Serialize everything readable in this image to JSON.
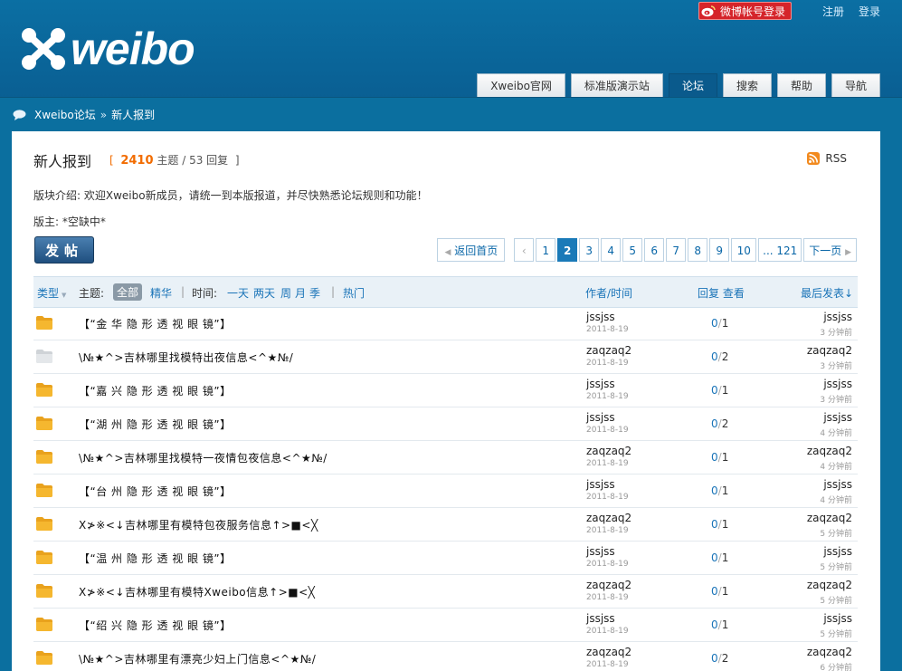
{
  "header": {
    "logo_text": "weibo",
    "weibo_login": "微博帐号登录",
    "register": "注册",
    "login": "登录",
    "nav": [
      "Xweibo官网",
      "标准版演示站",
      "论坛",
      "搜索",
      "帮助",
      "导航"
    ],
    "nav_active_index": 2
  },
  "breadcrumb": {
    "home": "Xweibo论坛",
    "sep": "»",
    "current": "新人报到"
  },
  "forum": {
    "title": "新人报到",
    "bracket_open": "[",
    "topics": "2410",
    "topics_label": "主题",
    "slash": "/",
    "replies": "53",
    "replies_label": "回复",
    "bracket_close": "]",
    "rss": "RSS",
    "intro": "版块介绍: 欢迎Xweibo新成员，请统一到本版报道，并尽快熟悉论坛规则和功能！",
    "moderator": "版主: *空缺中*",
    "post_button": "发帖"
  },
  "pager": {
    "home": "返回首页",
    "prev": "‹",
    "pages": [
      "1",
      "2",
      "3",
      "4",
      "5",
      "6",
      "7",
      "8",
      "9",
      "10"
    ],
    "current": "2",
    "more": "... 121",
    "next": "下一页"
  },
  "filter": {
    "type": "类型",
    "subject": "主题:",
    "all": "全部",
    "digest": "精华",
    "pipe": "|",
    "time": "时间:",
    "t1": "一天",
    "t2": "两天",
    "t3": "周",
    "t4": "月",
    "t5": "季",
    "hot": "热门",
    "author_time": "作者/时间",
    "replies_views": "回复 查看",
    "last_post": "最后发表↓"
  },
  "colors": {
    "header_blue": "#0b6fa3",
    "accent_orange": "#f26c00",
    "link_blue": "#1a74b8",
    "folder": "#f5b72f"
  },
  "threads": [
    {
      "title": "【“金 华 隐 形 透 视 眼 镜”】",
      "author": "jssjss",
      "date": "2011-8-19",
      "replies": "0",
      "views": "1",
      "last_user": "jssjss",
      "last_time": "3 分钟前",
      "icon": "folder"
    },
    {
      "title": "\\№★^>吉林哪里找模特出夜信息<^★№/",
      "author": "zaqzaq2",
      "date": "2011-8-19",
      "replies": "0",
      "views": "2",
      "last_user": "zaqzaq2",
      "last_time": "3 分钟前",
      "icon": "folder-gray"
    },
    {
      "title": "【“嘉 兴 隐 形 透 视 眼 镜”】",
      "author": "jssjss",
      "date": "2011-8-19",
      "replies": "0",
      "views": "1",
      "last_user": "jssjss",
      "last_time": "3 分钟前",
      "icon": "folder"
    },
    {
      "title": "【“湖 州 隐 形 透 视 眼 镜”】",
      "author": "jssjss",
      "date": "2011-8-19",
      "replies": "0",
      "views": "2",
      "last_user": "jssjss",
      "last_time": "4 分钟前",
      "icon": "folder"
    },
    {
      "title": "\\№★^>吉林哪里找模特一夜情包夜信息<^★№/",
      "author": "zaqzaq2",
      "date": "2011-8-19",
      "replies": "0",
      "views": "1",
      "last_user": "zaqzaq2",
      "last_time": "4 分钟前",
      "icon": "folder"
    },
    {
      "title": "【“台 州 隐 形 透 视 眼 镜”】",
      "author": "jssjss",
      "date": "2011-8-19",
      "replies": "0",
      "views": "1",
      "last_user": "jssjss",
      "last_time": "4 分钟前",
      "icon": "folder"
    },
    {
      "title": "X≯※<↓吉林哪里有模特包夜服务信息↑>■<╳",
      "author": "zaqzaq2",
      "date": "2011-8-19",
      "replies": "0",
      "views": "1",
      "last_user": "zaqzaq2",
      "last_time": "5 分钟前",
      "icon": "folder"
    },
    {
      "title": "【“温 州 隐 形 透 视 眼 镜”】",
      "author": "jssjss",
      "date": "2011-8-19",
      "replies": "0",
      "views": "1",
      "last_user": "jssjss",
      "last_time": "5 分钟前",
      "icon": "folder"
    },
    {
      "title": "X≯※<↓吉林哪里有模特Xweibo信息↑>■<╳",
      "author": "zaqzaq2",
      "date": "2011-8-19",
      "replies": "0",
      "views": "1",
      "last_user": "zaqzaq2",
      "last_time": "5 分钟前",
      "icon": "folder"
    },
    {
      "title": "【“绍 兴 隐 形 透 视 眼 镜”】",
      "author": "jssjss",
      "date": "2011-8-19",
      "replies": "0",
      "views": "1",
      "last_user": "jssjss",
      "last_time": "5 分钟前",
      "icon": "folder"
    },
    {
      "title": "\\№★^>吉林哪里有漂亮少妇上门信息<^★№/",
      "author": "zaqzaq2",
      "date": "2011-8-19",
      "replies": "0",
      "views": "2",
      "last_user": "zaqzaq2",
      "last_time": "6 分钟前",
      "icon": "folder"
    }
  ]
}
